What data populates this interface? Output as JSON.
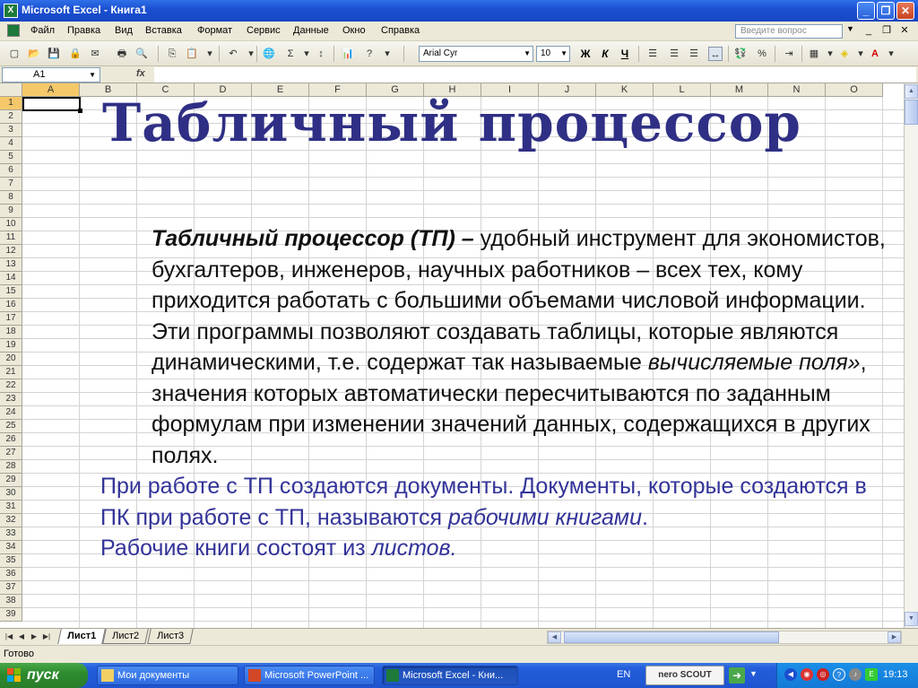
{
  "window": {
    "title": "Microsoft Excel - Книга1",
    "minimize": "_",
    "maximize": "❐",
    "close": "✕"
  },
  "menu": {
    "items": [
      "Файл",
      "Правка",
      "Вид",
      "Вставка",
      "Формат",
      "Сервис",
      "Данные",
      "Окно",
      "Справка"
    ],
    "question_placeholder": "Введите вопрос"
  },
  "toolbar": {
    "font_name": "Arial Cyr",
    "font_size": "10",
    "bold": "Ж",
    "italic": "К",
    "underline": "Ч",
    "sum": "Σ",
    "percent": "%"
  },
  "formula_bar": {
    "cell_ref": "A1",
    "fx": "fx",
    "value": ""
  },
  "grid": {
    "columns": [
      "A",
      "B",
      "C",
      "D",
      "E",
      "F",
      "G",
      "H",
      "I",
      "J",
      "K",
      "L",
      "M",
      "N",
      "O"
    ],
    "rows": [
      "1",
      "2",
      "3",
      "4",
      "5",
      "6",
      "7",
      "8",
      "9",
      "10",
      "11",
      "12",
      "13",
      "14",
      "15",
      "16",
      "17",
      "18",
      "19",
      "20",
      "21",
      "22",
      "23",
      "24",
      "25",
      "26",
      "27",
      "28",
      "29",
      "30",
      "31",
      "32",
      "33",
      "34",
      "35",
      "36",
      "37",
      "38",
      "39"
    ]
  },
  "slide": {
    "title": "Табличный процессор",
    "p1_term": "Табличный процессор (ТП) –",
    "p1_rest": " удобный инструмент для экономистов, бухгалтеров, инженеров, научных работников – всех тех, кому приходится работать с большими объемами числовой информации.",
    "p2_start": "Эти программы позволяют создавать таблицы, которые являются динамическими, т.е. содержат так называемые ",
    "p2_em": "вычисляемые поля»",
    "p2_end": ", значения которых  автоматически пересчитываются по заданным формулам при изменении значений данных, содержащихся в других полях.",
    "p3_start": "При работе с ТП создаются документы. Документы, которые создаются в ПК при работе с ТП, называются ",
    "p3_em": "рабочими книгами",
    "p3_end": ".",
    "p4_start": "Рабочие книги состоят из ",
    "p4_em": "листов."
  },
  "sheet_tabs": [
    "Лист1",
    "Лист2",
    "Лист3"
  ],
  "status": {
    "ready": "Готово"
  },
  "taskbar": {
    "start": "пуск",
    "tasks": [
      "Мои документы",
      "Microsoft PowerPoint ...",
      "Microsoft Excel - Кни..."
    ],
    "lang": "EN",
    "nero": "nero SCOUT",
    "clock": "19:13"
  },
  "colors": {
    "title_color": "#2f2f85",
    "blue_text": "#333399",
    "titlebar": "#1a4fd0",
    "taskbar": "#245edb",
    "start_green": "#2e8b2e"
  }
}
